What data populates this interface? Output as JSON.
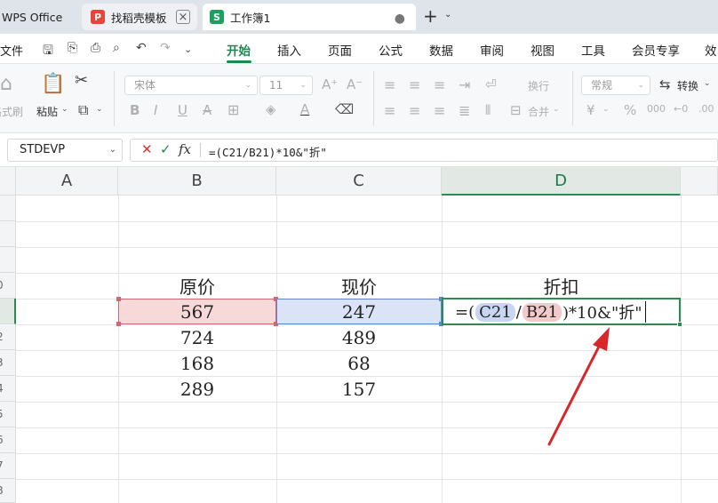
{
  "tabs": {
    "app_label": "WPS Office",
    "template_tab": "找稻壳模板",
    "template_badge": "P",
    "workbook_tab": "工作簿1",
    "workbook_badge": "S"
  },
  "menu": {
    "file": "文件",
    "items": [
      "开始",
      "插入",
      "页面",
      "公式",
      "数据",
      "审阅",
      "视图",
      "工具",
      "会员专享",
      "效"
    ],
    "active_index": 0
  },
  "ribbon": {
    "format_painter": "格式刷",
    "paste": "粘贴",
    "font_name": "宋体",
    "font_size": "11",
    "wrap": "换行",
    "merge": "合并",
    "number_format": "常规",
    "convert": "转换"
  },
  "formula_bar": {
    "name_box": "STDEVP",
    "formula": "=(C21/B21)*10&\"折\""
  },
  "grid": {
    "columns": [
      "A",
      "B",
      "C",
      "D"
    ],
    "selected_column": "D",
    "row_labels": [
      "0",
      "",
      "2",
      "3",
      "4",
      "5",
      "6",
      "7",
      "8"
    ],
    "header_row": {
      "b": "原价",
      "c": "现价",
      "d": "折扣"
    },
    "rows": [
      {
        "b": "567",
        "c": "247"
      },
      {
        "b": "724",
        "c": "489"
      },
      {
        "b": "168",
        "c": "68"
      },
      {
        "b": "289",
        "c": "157"
      }
    ],
    "edit": {
      "prefix": "=(",
      "ref1": "C21",
      "slash": "/",
      "ref2": "B21",
      "suffix": ")*10&\"折\""
    }
  },
  "colors": {
    "accent": "#1b8a4f",
    "ref_blue": "#5f86cf",
    "ref_red": "#d16870",
    "annotation_arrow": "#d8262a"
  }
}
